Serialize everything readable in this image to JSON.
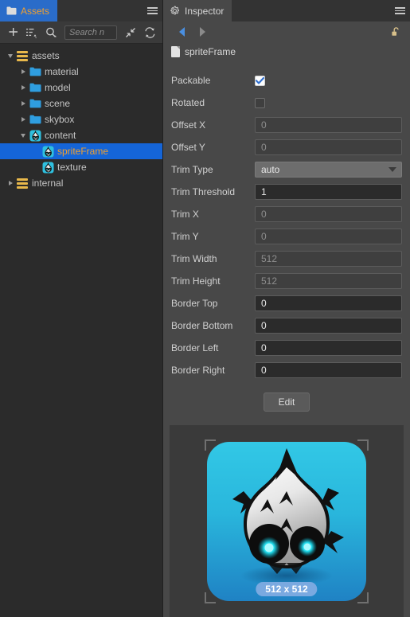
{
  "assets_panel": {
    "tab": {
      "label": "Assets",
      "icon": "folder-icon"
    },
    "menu_icon": "hamburger-menu-icon",
    "toolbar": {
      "add_label": "+",
      "add_icon": "plus-icon",
      "sort_icon": "sort-icon",
      "filter_icon": "search-filter-icon",
      "collapse_icon": "collapse-all-icon",
      "refresh_icon": "refresh-icon"
    },
    "search": {
      "value": "",
      "placeholder": "Search n"
    },
    "tree": [
      {
        "label": "assets",
        "depth": 0,
        "icon": "database-icon",
        "expanded": true,
        "arrow": "down",
        "selected": false
      },
      {
        "label": "material",
        "depth": 1,
        "icon": "folder-icon",
        "expanded": false,
        "arrow": "right",
        "selected": false
      },
      {
        "label": "model",
        "depth": 1,
        "icon": "folder-icon",
        "expanded": false,
        "arrow": "right",
        "selected": false
      },
      {
        "label": "scene",
        "depth": 1,
        "icon": "folder-icon",
        "expanded": false,
        "arrow": "right",
        "selected": false
      },
      {
        "label": "skybox",
        "depth": 1,
        "icon": "folder-icon",
        "expanded": false,
        "arrow": "right",
        "selected": false
      },
      {
        "label": "content",
        "depth": 1,
        "icon": "sprite-icon",
        "expanded": true,
        "arrow": "down",
        "selected": false
      },
      {
        "label": "spriteFrame",
        "depth": 2,
        "icon": "sprite-icon",
        "expanded": false,
        "arrow": "none",
        "selected": true
      },
      {
        "label": "texture",
        "depth": 2,
        "icon": "sprite-icon",
        "expanded": false,
        "arrow": "none",
        "selected": false
      },
      {
        "label": "internal",
        "depth": 0,
        "icon": "database-icon",
        "expanded": false,
        "arrow": "right",
        "selected": false
      }
    ]
  },
  "inspector": {
    "tab": {
      "label": "Inspector",
      "icon": "gear-icon"
    },
    "menu_icon": "hamburger-menu-icon",
    "nav": {
      "back_icon": "arrow-back-icon",
      "forward_icon": "arrow-forward-icon",
      "lock_icon": "unlock-icon"
    },
    "asset": {
      "name": "spriteFrame",
      "icon": "file-icon"
    },
    "properties": [
      {
        "label": "Packable",
        "type": "checkbox",
        "value": true,
        "enabled": true
      },
      {
        "label": "Rotated",
        "type": "checkbox",
        "value": false,
        "enabled": true
      },
      {
        "label": "Offset X",
        "type": "input",
        "value": "0",
        "enabled": false
      },
      {
        "label": "Offset Y",
        "type": "input",
        "value": "0",
        "enabled": false
      },
      {
        "label": "Trim Type",
        "type": "select",
        "value": "auto",
        "enabled": true
      },
      {
        "label": "Trim Threshold",
        "type": "input",
        "value": "1",
        "enabled": true
      },
      {
        "label": "Trim X",
        "type": "input",
        "value": "0",
        "enabled": false
      },
      {
        "label": "Trim Y",
        "type": "input",
        "value": "0",
        "enabled": false
      },
      {
        "label": "Trim Width",
        "type": "input",
        "value": "512",
        "enabled": false
      },
      {
        "label": "Trim Height",
        "type": "input",
        "value": "512",
        "enabled": false
      },
      {
        "label": "Border Top",
        "type": "input",
        "value": "0",
        "enabled": true
      },
      {
        "label": "Border Bottom",
        "type": "input",
        "value": "0",
        "enabled": true
      },
      {
        "label": "Border Left",
        "type": "input",
        "value": "0",
        "enabled": true
      },
      {
        "label": "Border Right",
        "type": "input",
        "value": "0",
        "enabled": true
      }
    ],
    "edit_button": {
      "label": "Edit"
    },
    "preview": {
      "size_label": "512 x 512",
      "image": "cocos-creator-sprite"
    }
  },
  "colors": {
    "tab_active": "#2a6cc9",
    "tab_active_text": "#f0a030",
    "panel_bg": "#2b2b2b",
    "inspector_bg": "#484848",
    "input_disabled_bg": "#3f3f3f",
    "input_active_bg": "#2b2b2b",
    "selection_blue": "#1565d8",
    "badge_blue": "#7aa9e0",
    "sprite_cyan": "#32c8e6"
  }
}
